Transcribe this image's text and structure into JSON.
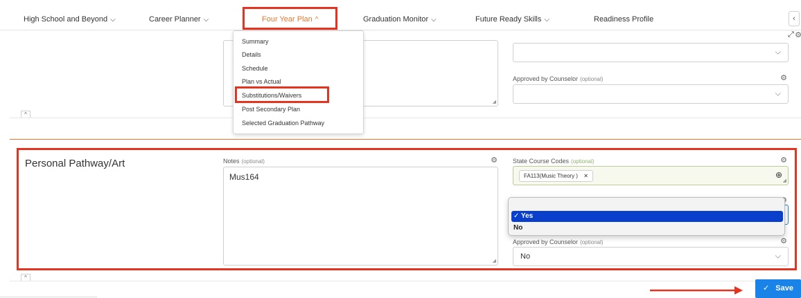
{
  "nav": {
    "items": [
      {
        "label": "High School and Beyond",
        "chevron": "⌵"
      },
      {
        "label": "Career Planner",
        "chevron": "⌵"
      },
      {
        "label": "Four Year Plan",
        "chevron": "^"
      },
      {
        "label": "Graduation Monitor",
        "chevron": "⌵"
      },
      {
        "label": "Future Ready Skills",
        "chevron": "⌵"
      },
      {
        "label": "Readiness Profile",
        "chevron": ""
      }
    ],
    "collapse_icon": "‹"
  },
  "plan_menu": {
    "items": [
      "Summary",
      "Details",
      "Schedule",
      "Plan vs Actual",
      "Substitutions/Waivers",
      "Post Secondary Plan",
      "Selected Graduation Pathway"
    ]
  },
  "upper_section": {
    "approved_label": "Approved by Counselor",
    "optional": "(optional)"
  },
  "pathway_section": {
    "title": "Personal Pathway/Art",
    "notes_label": "Notes",
    "notes_optional": "(optional)",
    "notes_value": "Mus164",
    "state_codes_label": "State Course Codes",
    "state_codes_optional": "(optional)",
    "chip_label": "FA113(Music Theory )",
    "chip_remove": "✕",
    "approved_label": "Approved by Counselor",
    "approved_optional": "(optional)",
    "approved_value": "No"
  },
  "yesno_popup": {
    "options": [
      {
        "label": "✓ Yes",
        "selected": true
      },
      {
        "label": "No",
        "selected": false
      }
    ]
  },
  "save": {
    "label": "Save",
    "check": "✓"
  },
  "colors": {
    "accent_orange": "#e8772e",
    "highlight_red": "#e5331f",
    "save_blue": "#1a83e8",
    "select_blue": "#0a3fcc"
  }
}
